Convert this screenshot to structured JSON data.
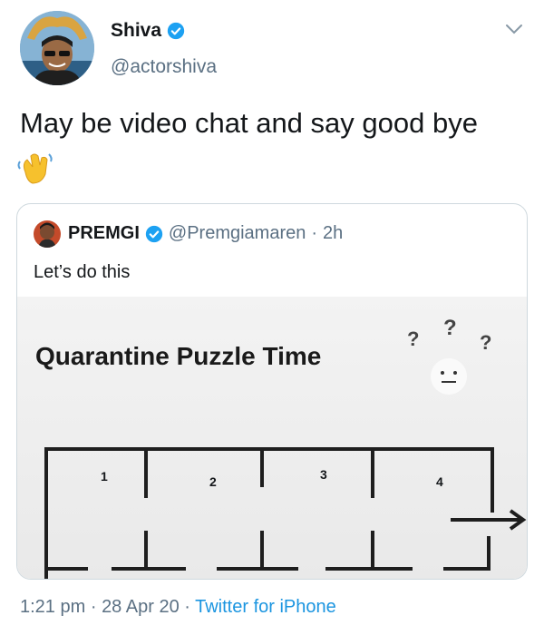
{
  "tweet": {
    "author_name": "Shiva",
    "author_handle": "@actorshiva",
    "text": "May be video chat and say good bye",
    "emoji": "waving-hand-icon"
  },
  "quoted_tweet": {
    "author_name": "PREMGI",
    "author_handle": "@Premgiamaren",
    "separator": "·",
    "time": "2h",
    "text": "Let’s do this",
    "image": {
      "title": "Quarantine Puzzle Time",
      "room_numbers": [
        "1",
        "2",
        "3",
        "4"
      ]
    }
  },
  "footer": {
    "time": "1:21 pm",
    "dot1": "·",
    "date": "28 Apr 20",
    "dot2": "·",
    "source": "Twitter for iPhone"
  },
  "colors": {
    "verified": "#1da1f2",
    "secondary_text": "#5b7083",
    "link": "#1b95e0",
    "border": "#cfd9de"
  }
}
